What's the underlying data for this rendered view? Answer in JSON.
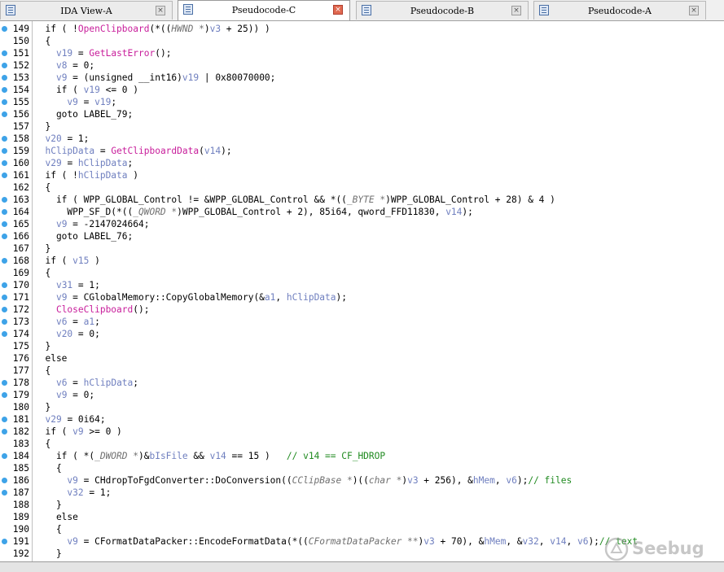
{
  "tabs": [
    {
      "label": "IDA View-A",
      "active": false
    },
    {
      "label": "Pseudocode-C",
      "active": true
    },
    {
      "label": "Pseudocode-B",
      "active": false
    },
    {
      "label": "Pseudocode-A",
      "active": false
    }
  ],
  "close_glyph": "×",
  "lines": [
    {
      "n": "149",
      "bp": true,
      "code": "  if ( !<fn>OpenClipboard</fn>(*((<ty>HWND *</ty>)<var>v3</var> + 25)) )"
    },
    {
      "n": "150",
      "bp": false,
      "code": "  {"
    },
    {
      "n": "151",
      "bp": true,
      "code": "    <var>v19</var> = <fn>GetLastError</fn>();"
    },
    {
      "n": "152",
      "bp": true,
      "code": "    <var>v8</var> = 0;"
    },
    {
      "n": "153",
      "bp": true,
      "code": "    <var>v9</var> = (unsigned __int16)<var>v19</var> | 0x80070000;"
    },
    {
      "n": "154",
      "bp": true,
      "code": "    if ( <var>v19</var> <= 0 )"
    },
    {
      "n": "155",
      "bp": true,
      "code": "      <var>v9</var> = <var>v19</var>;"
    },
    {
      "n": "156",
      "bp": true,
      "code": "    goto LABEL_79;"
    },
    {
      "n": "157",
      "bp": false,
      "code": "  }"
    },
    {
      "n": "158",
      "bp": true,
      "code": "  <var>v20</var> = 1;"
    },
    {
      "n": "159",
      "bp": true,
      "code": "  <var>hClipData</var> = <fn>GetClipboardData</fn>(<var>v14</var>);"
    },
    {
      "n": "160",
      "bp": true,
      "code": "  <var>v29</var> = <var>hClipData</var>;"
    },
    {
      "n": "161",
      "bp": true,
      "code": "  if ( !<var>hClipData</var> )"
    },
    {
      "n": "162",
      "bp": false,
      "code": "  {"
    },
    {
      "n": "163",
      "bp": true,
      "code": "    if ( WPP_GLOBAL_Control != &WPP_GLOBAL_Control && *((<ty>_BYTE *</ty>)WPP_GLOBAL_Control + 28) & 4 )"
    },
    {
      "n": "164",
      "bp": true,
      "code": "      WPP_SF_D(*((<ty>_QWORD *</ty>)WPP_GLOBAL_Control + 2), 85i64, qword_FFD11830, <var>v14</var>);"
    },
    {
      "n": "165",
      "bp": true,
      "code": "    <var>v9</var> = -2147024664;"
    },
    {
      "n": "166",
      "bp": true,
      "code": "    goto LABEL_76;"
    },
    {
      "n": "167",
      "bp": false,
      "code": "  }"
    },
    {
      "n": "168",
      "bp": true,
      "code": "  if ( <var>v15</var> )"
    },
    {
      "n": "169",
      "bp": false,
      "code": "  {"
    },
    {
      "n": "170",
      "bp": true,
      "code": "    <var>v31</var> = 1;"
    },
    {
      "n": "171",
      "bp": true,
      "code": "    <var>v9</var> = CGlobalMemory::CopyGlobalMemory(&<var>a1</var>, <var>hClipData</var>);"
    },
    {
      "n": "172",
      "bp": true,
      "code": "    <fn>CloseClipboard</fn>();"
    },
    {
      "n": "173",
      "bp": true,
      "code": "    <var>v6</var> = <var>a1</var>;"
    },
    {
      "n": "174",
      "bp": true,
      "code": "    <var>v20</var> = 0;"
    },
    {
      "n": "175",
      "bp": false,
      "code": "  }"
    },
    {
      "n": "176",
      "bp": false,
      "code": "  else"
    },
    {
      "n": "177",
      "bp": false,
      "code": "  {"
    },
    {
      "n": "178",
      "bp": true,
      "code": "    <var>v6</var> = <var>hClipData</var>;"
    },
    {
      "n": "179",
      "bp": true,
      "code": "    <var>v9</var> = 0;"
    },
    {
      "n": "180",
      "bp": false,
      "code": "  }"
    },
    {
      "n": "181",
      "bp": true,
      "code": "  <var>v29</var> = 0i64;"
    },
    {
      "n": "182",
      "bp": true,
      "code": "  if ( <var>v9</var> >= 0 )"
    },
    {
      "n": "183",
      "bp": false,
      "code": "  {"
    },
    {
      "n": "184",
      "bp": true,
      "code": "    if ( *(<ty>_DWORD *</ty>)&<var>bIsFile</var> && <var>v14</var> == 15 )   <cm>// v14 == CF_HDROP</cm>"
    },
    {
      "n": "185",
      "bp": false,
      "code": "    {"
    },
    {
      "n": "186",
      "bp": true,
      "code": "      <var>v9</var> = CHdropToFgdConverter::DoConversion((<ty>CClipBase *</ty>)((<ty>char *</ty>)<var>v3</var> + 256), &<var>hMem</var>, <var>v6</var>);<cm>// files</cm>"
    },
    {
      "n": "187",
      "bp": true,
      "code": "      <var>v32</var> = 1;"
    },
    {
      "n": "188",
      "bp": false,
      "code": "    }"
    },
    {
      "n": "189",
      "bp": false,
      "code": "    else"
    },
    {
      "n": "190",
      "bp": false,
      "code": "    {"
    },
    {
      "n": "191",
      "bp": true,
      "code": "      <var>v9</var> = CFormatDataPacker::EncodeFormatData(*((<ty>CFormatDataPacker **</ty>)<var>v3</var> + 70), &<var>hMem</var>, &<var>v32</var>, <var>v14</var>, <var>v6</var>);<cm>// text</cm>"
    },
    {
      "n": "192",
      "bp": false,
      "code": "    }"
    }
  ],
  "status_text": "",
  "watermark": "Seebug",
  "colors": {
    "breakpoint": "#3ea3e8",
    "variable": "#6f7fbf",
    "function": "#c81e9b",
    "type": "#707070",
    "comment": "#1f8a1f"
  }
}
